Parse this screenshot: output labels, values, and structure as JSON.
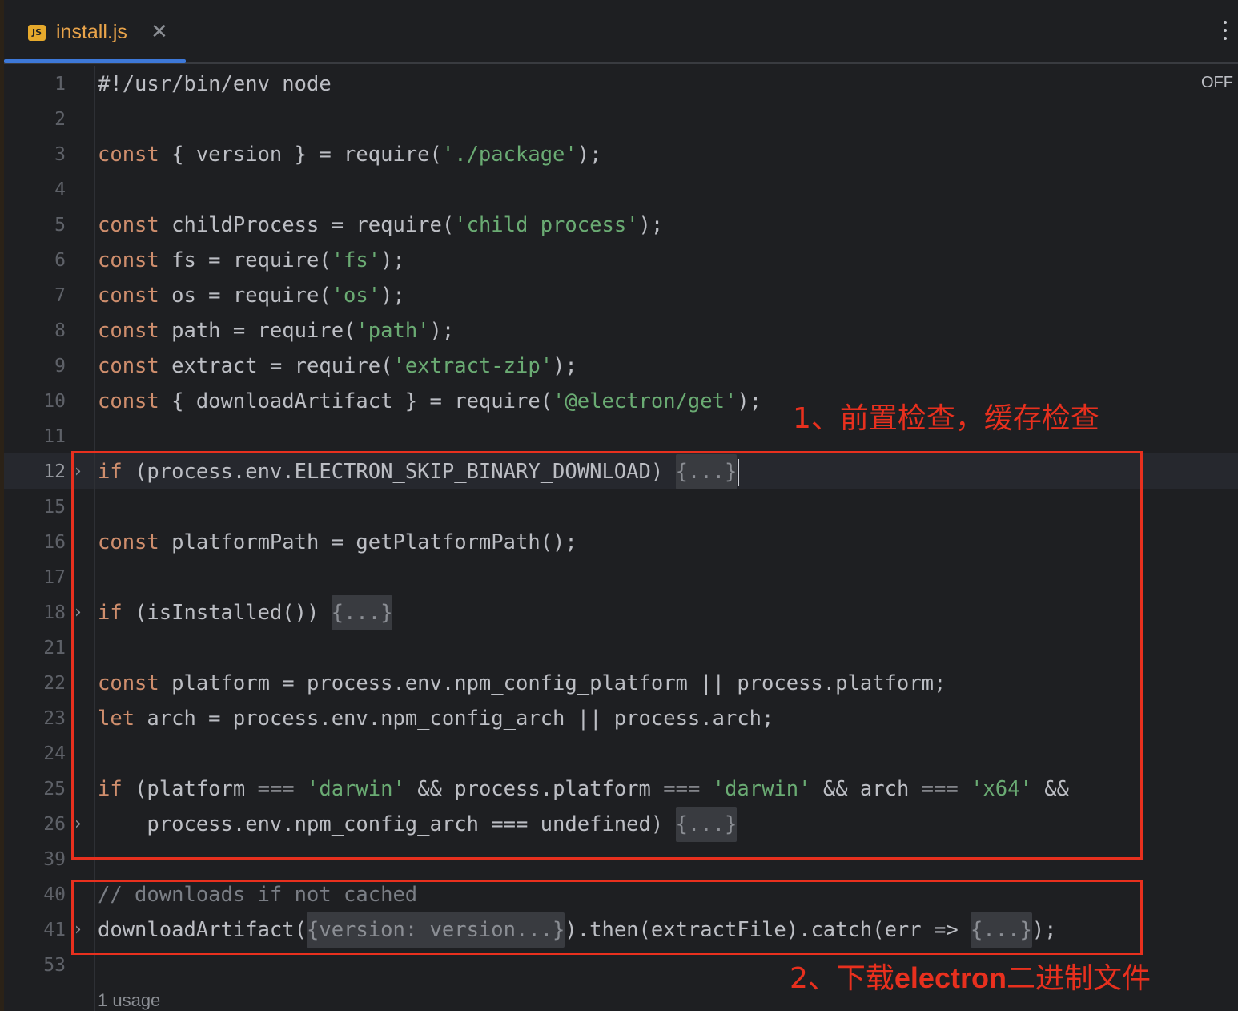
{
  "tab": {
    "icon_text": "JS",
    "filename": "install.js",
    "close_glyph": "✕"
  },
  "toolbar": {
    "off_label": "OFF"
  },
  "lines": [
    {
      "num": "1",
      "fold": "",
      "tokens": [
        [
          "cmt-lite",
          "#!/usr/bin/env node"
        ]
      ]
    },
    {
      "num": "2",
      "fold": "",
      "tokens": []
    },
    {
      "num": "3",
      "fold": "",
      "tokens": [
        [
          "kw",
          "const"
        ],
        [
          "p",
          " { version } = require("
        ],
        [
          "str",
          "'./package'"
        ],
        [
          "p",
          ");"
        ]
      ]
    },
    {
      "num": "4",
      "fold": "",
      "tokens": []
    },
    {
      "num": "5",
      "fold": "",
      "tokens": [
        [
          "kw",
          "const"
        ],
        [
          "p",
          " childProcess = require("
        ],
        [
          "str",
          "'child_process'"
        ],
        [
          "p",
          ");"
        ]
      ]
    },
    {
      "num": "6",
      "fold": "",
      "tokens": [
        [
          "kw",
          "const"
        ],
        [
          "p",
          " fs = require("
        ],
        [
          "str",
          "'fs'"
        ],
        [
          "p",
          ");"
        ]
      ]
    },
    {
      "num": "7",
      "fold": "",
      "tokens": [
        [
          "kw",
          "const"
        ],
        [
          "p",
          " os = require("
        ],
        [
          "str",
          "'os'"
        ],
        [
          "p",
          ");"
        ]
      ]
    },
    {
      "num": "8",
      "fold": "",
      "tokens": [
        [
          "kw",
          "const"
        ],
        [
          "p",
          " path = require("
        ],
        [
          "str",
          "'path'"
        ],
        [
          "p",
          ");"
        ]
      ]
    },
    {
      "num": "9",
      "fold": "",
      "tokens": [
        [
          "kw",
          "const"
        ],
        [
          "p",
          " extract = require("
        ],
        [
          "str",
          "'extract-zip'"
        ],
        [
          "p",
          ");"
        ]
      ]
    },
    {
      "num": "10",
      "fold": "",
      "tokens": [
        [
          "kw",
          "const"
        ],
        [
          "p",
          " { downloadArtifact } = require("
        ],
        [
          "str",
          "'@electron/get'"
        ],
        [
          "p",
          ");"
        ]
      ]
    },
    {
      "num": "11",
      "fold": "",
      "tokens": []
    },
    {
      "num": "12",
      "fold": ">",
      "active": true,
      "tokens": [
        [
          "kw",
          "if"
        ],
        [
          "p",
          " (process.env.ELECTRON_SKIP_BINARY_DOWNLOAD) "
        ],
        [
          "ph",
          "{...}"
        ],
        [
          "caret",
          ""
        ]
      ]
    },
    {
      "num": "15",
      "fold": "",
      "tokens": []
    },
    {
      "num": "16",
      "fold": "",
      "tokens": [
        [
          "kw",
          "const"
        ],
        [
          "p",
          " platformPath = getPlatformPath();"
        ]
      ]
    },
    {
      "num": "17",
      "fold": "",
      "tokens": []
    },
    {
      "num": "18",
      "fold": ">",
      "tokens": [
        [
          "kw",
          "if"
        ],
        [
          "p",
          " (isInstalled()) "
        ],
        [
          "ph",
          "{...}"
        ]
      ]
    },
    {
      "num": "21",
      "fold": "",
      "tokens": []
    },
    {
      "num": "22",
      "fold": "",
      "tokens": [
        [
          "kw",
          "const"
        ],
        [
          "p",
          " platform = process.env.npm_config_platform || process.platform;"
        ]
      ]
    },
    {
      "num": "23",
      "fold": "",
      "tokens": [
        [
          "kw",
          "let"
        ],
        [
          "p",
          " arch = process.env.npm_config_arch || process.arch;"
        ]
      ]
    },
    {
      "num": "24",
      "fold": "",
      "tokens": []
    },
    {
      "num": "25",
      "fold": "",
      "tokens": [
        [
          "kw",
          "if"
        ],
        [
          "p",
          " (platform === "
        ],
        [
          "str",
          "'darwin'"
        ],
        [
          "p",
          " && process.platform === "
        ],
        [
          "str",
          "'darwin'"
        ],
        [
          "p",
          " && arch === "
        ],
        [
          "str",
          "'x64'"
        ],
        [
          "p",
          " &&"
        ]
      ]
    },
    {
      "num": "26",
      "fold": ">",
      "tokens": [
        [
          "p",
          "    process.env.npm_config_arch === undefined) "
        ],
        [
          "ph",
          "{...}"
        ]
      ]
    },
    {
      "num": "39",
      "fold": "",
      "tokens": []
    },
    {
      "num": "40",
      "fold": "",
      "tokens": [
        [
          "cmt",
          "// downloads if not cached"
        ]
      ]
    },
    {
      "num": "41",
      "fold": ">",
      "tokens": [
        [
          "p",
          "downloadArtifact("
        ],
        [
          "ph",
          "{version: version...}"
        ],
        [
          "p",
          ").then(extractFile).catch(err => "
        ],
        [
          "ph",
          "{...}"
        ],
        [
          "p",
          ");"
        ]
      ]
    },
    {
      "num": "53",
      "fold": "",
      "tokens": []
    }
  ],
  "usage_hint": "1 usage",
  "annotations": {
    "note1": "1、前置检查，缓存检查",
    "note2_prefix": "2、下载",
    "note2_bold": "electron",
    "note2_suffix": "二进制文件"
  },
  "colors": {
    "background": "#1e1f22",
    "keyword": "#cf8e6d",
    "string": "#6aab73",
    "comment": "#7a7e85",
    "annotation_red": "#e8301e",
    "tab_accent": "#3d78d8"
  }
}
